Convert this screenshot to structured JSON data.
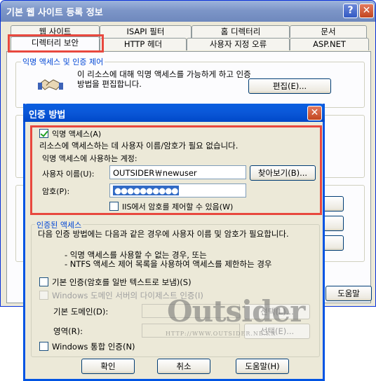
{
  "outer": {
    "title": "기본 웹 사이트 등록 정보",
    "help_icon": "?",
    "close_icon": "✕",
    "tabs_row1": [
      "웹 사이트",
      "ISAPI 필터",
      "홈 디렉터리",
      "문서"
    ],
    "tabs_row2": [
      "디렉터리 보안",
      "HTTP 헤더",
      "사용자 지정 오류",
      "ASP.NET"
    ],
    "anon_group_label": "익명 액세스 및 인증 제어",
    "anon_desc": "이 리소스에 대해 익명 액세스를 가능하게 하고 인증 방법을 편집합니다.",
    "edit_button": "편집(E)...",
    "help_button": "도움말"
  },
  "dialog": {
    "title": "인증 방법",
    "close_icon": "✕",
    "anon_checkbox": "익명 액세스(A)",
    "anon_checked": true,
    "anon_info": "리소스에 액세스하는 데 사용자 이름/암호가 필요 없습니다.",
    "account_label": "익명 액세스에 사용하는 계정:",
    "username_label": "사용자 이름(U):",
    "username_value": "OUTSIDER￦newuser",
    "browse_button": "찾아보기(B)...",
    "password_label": "암호(P):",
    "password_value": "●●●●●●●●●●",
    "iis_pw_checkbox": "IIS에서 암호를 제어할 수 있음(W)",
    "iis_pw_checked": false,
    "auth_group_label": "인증된 액세스",
    "auth_desc": "다음 인증 방법에는 다음과 같은 경우에 사용자 이름 및 암호가 필요합니다.",
    "auth_bullet1": "- 익명 액세스를 사용할 수 없는 경우, 또는",
    "auth_bullet2": "- NTFS 액세스 제어 목록을 사용하여 액세스를 제한하는 경우",
    "basic_checkbox": "기본 인증(암호를 일반 텍스트로 보냄)(S)",
    "digest_checkbox": "Windows 도메인 서버의 다이제스트 인증(I)",
    "default_domain_label": "기본 도메인(D):",
    "realm_label": "영역(R):",
    "select_button_1": "선택(L)...",
    "select_button_2": "선택(E)...",
    "windows_auth_checkbox": "Windows 통합 인증(N)",
    "ok_button": "확인",
    "cancel_button": "취소",
    "help_button": "도움말(H)"
  },
  "watermark": {
    "logo_text": "Outsider",
    "url": "HTTP://WWW.OUTSIDER.NE.KR"
  },
  "colors": {
    "highlight": "#e8483e",
    "dialog_title_bar": "#0054e3",
    "group_label": "#0046d5"
  }
}
